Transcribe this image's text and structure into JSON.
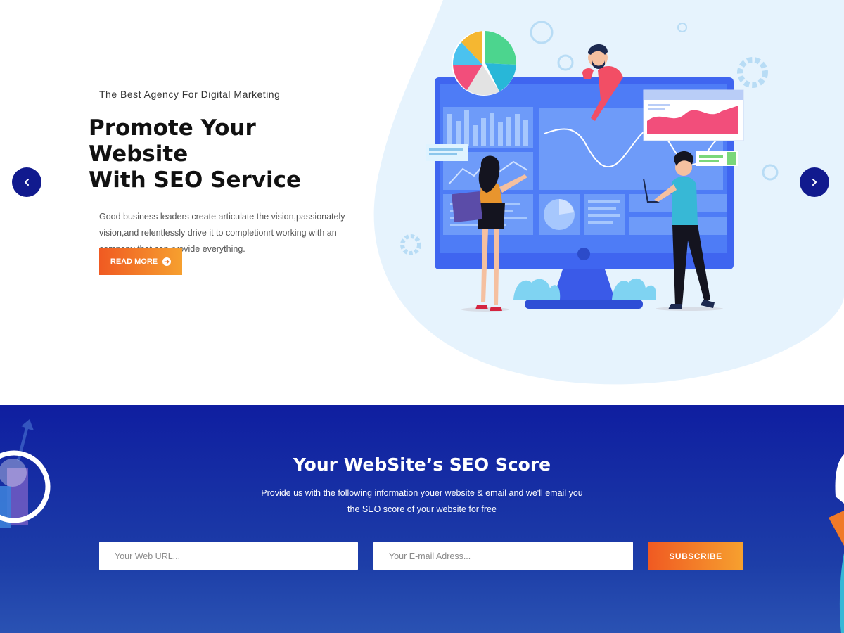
{
  "hero": {
    "eyebrow": "The Best Agency For Digital Marketing",
    "headline_line1": "Promote Your Website",
    "headline_line2": "With SEO Service",
    "description": "Good business leaders create articulate the vision,passionately vision,and relentlessly drive it to completionrt working with an company that can provide everything.",
    "read_more_label": "READ MORE",
    "prev_icon": "chevron-left-icon",
    "next_icon": "chevron-right-icon"
  },
  "seo_score": {
    "title": "Your WebSite’s SEO Score",
    "subtitle_line1": "Provide us with the following information youer website & email and we'll email you",
    "subtitle_line2": "the SEO score of your website for free",
    "url_placeholder": "Your Web URL...",
    "email_placeholder": "Your E-mail Adress...",
    "subscribe_label": "SUBSCRIBE"
  },
  "colors": {
    "accent_orange_start": "#f05a22",
    "accent_orange_end": "#f6a02f",
    "nav_blue": "#111a8e",
    "section_blue": "#1428a0",
    "blob_light": "#e6f3fd"
  }
}
